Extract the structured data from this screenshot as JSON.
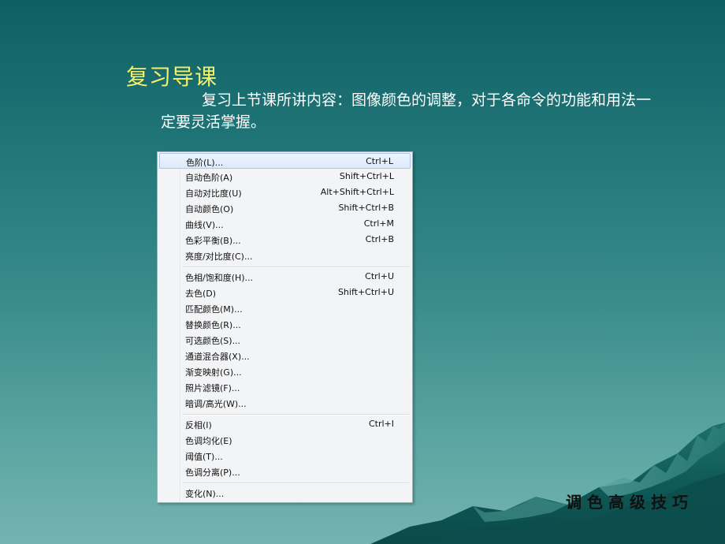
{
  "slide": {
    "title": "复习导课",
    "paragraph": "复习上节课所讲内容：图像颜色的调整，对于各命令的功能和用法一定要灵活掌握。",
    "footer": "调色高级技巧"
  },
  "menu": {
    "items": [
      {
        "label": "色阶(L)...",
        "shortcut": "Ctrl+L"
      },
      {
        "label": "自动色阶(A)",
        "shortcut": "Shift+Ctrl+L"
      },
      {
        "label": "自动对比度(U)",
        "shortcut": "Alt+Shift+Ctrl+L"
      },
      {
        "label": "自动颜色(O)",
        "shortcut": "Shift+Ctrl+B"
      },
      {
        "label": "曲线(V)...",
        "shortcut": "Ctrl+M"
      },
      {
        "label": "色彩平衡(B)...",
        "shortcut": "Ctrl+B"
      },
      {
        "label": "亮度/对比度(C)...",
        "shortcut": ""
      },
      {
        "label": "色相/饱和度(H)...",
        "shortcut": "Ctrl+U"
      },
      {
        "label": "去色(D)",
        "shortcut": "Shift+Ctrl+U"
      },
      {
        "label": "匹配颜色(M)...",
        "shortcut": ""
      },
      {
        "label": "替换颜色(R)...",
        "shortcut": ""
      },
      {
        "label": "可选颜色(S)...",
        "shortcut": ""
      },
      {
        "label": "通道混合器(X)...",
        "shortcut": ""
      },
      {
        "label": "渐变映射(G)...",
        "shortcut": ""
      },
      {
        "label": "照片滤镜(F)...",
        "shortcut": ""
      },
      {
        "label": "暗调/高光(W)...",
        "shortcut": ""
      },
      {
        "label": "反相(I)",
        "shortcut": "Ctrl+I"
      },
      {
        "label": "色调均化(E)",
        "shortcut": ""
      },
      {
        "label": "阈值(T)...",
        "shortcut": ""
      },
      {
        "label": "色调分离(P)...",
        "shortcut": ""
      },
      {
        "label": "变化(N)...",
        "shortcut": ""
      }
    ]
  }
}
